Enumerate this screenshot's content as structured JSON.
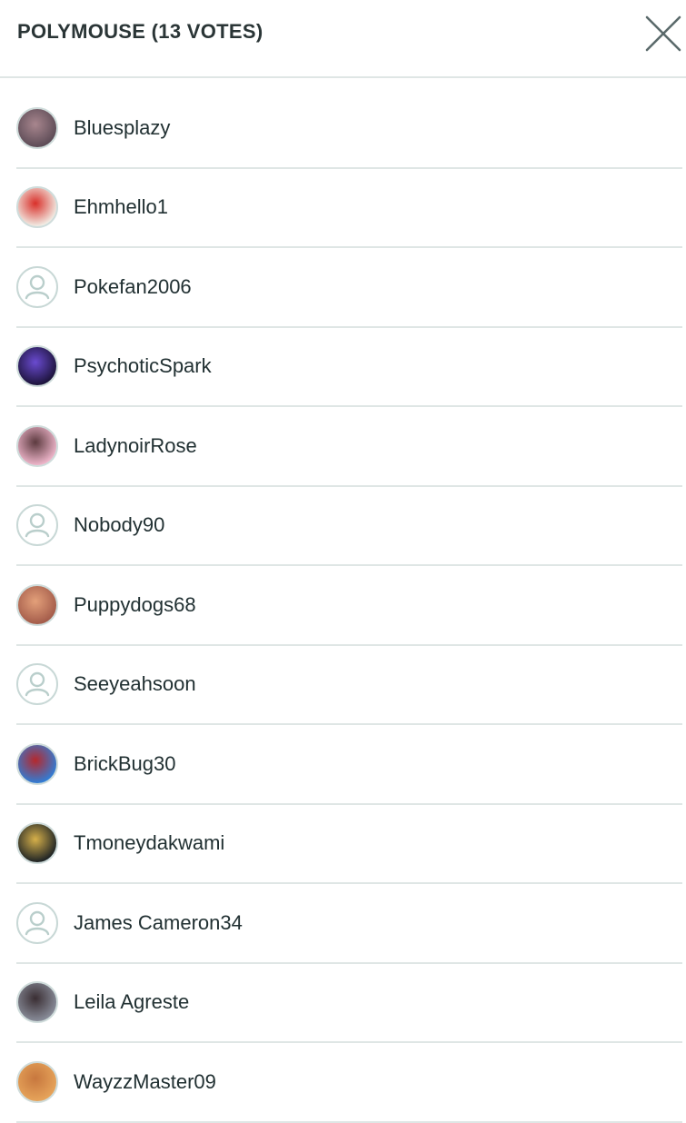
{
  "header": {
    "title": "POLYMOUSE (13 VOTES)",
    "close_icon": "close-icon"
  },
  "voters": [
    {
      "name": "Bluesplazy",
      "avatar": "photo",
      "avatar_colors": [
        "#5b4a55",
        "#a8868e"
      ]
    },
    {
      "name": "Ehmhello1",
      "avatar": "photo",
      "avatar_colors": [
        "#f2f0e8",
        "#d9302a"
      ]
    },
    {
      "name": "Pokefan2006",
      "avatar": "default-user-icon",
      "avatar_colors": []
    },
    {
      "name": "PsychoticSpark",
      "avatar": "photo",
      "avatar_colors": [
        "#1b1238",
        "#6a4bd0"
      ]
    },
    {
      "name": "LadynoirRose",
      "avatar": "photo",
      "avatar_colors": [
        "#f1b8cd",
        "#5c3a3f"
      ]
    },
    {
      "name": "Nobody90",
      "avatar": "default-user-icon",
      "avatar_colors": []
    },
    {
      "name": "Puppydogs68",
      "avatar": "photo",
      "avatar_colors": [
        "#a25a49",
        "#e3a07a"
      ]
    },
    {
      "name": "Seeyeahsoon",
      "avatar": "default-user-icon",
      "avatar_colors": []
    },
    {
      "name": "BrickBug30",
      "avatar": "photo",
      "avatar_colors": [
        "#2e7fd9",
        "#b5282c"
      ]
    },
    {
      "name": "Tmoneydakwami",
      "avatar": "photo",
      "avatar_colors": [
        "#1a2024",
        "#d6b04a"
      ]
    },
    {
      "name": "James Cameron34",
      "avatar": "default-user-icon",
      "avatar_colors": []
    },
    {
      "name": "Leila Agreste",
      "avatar": "photo",
      "avatar_colors": [
        "#8a8e9b",
        "#3a2e33"
      ]
    },
    {
      "name": "WayzzMaster09",
      "avatar": "photo",
      "avatar_colors": [
        "#e7a55b",
        "#c7773e"
      ]
    }
  ],
  "colors": {
    "divider": "#dfe6e5",
    "text": "#213032",
    "placeholder_stroke": "#b9cecb"
  }
}
